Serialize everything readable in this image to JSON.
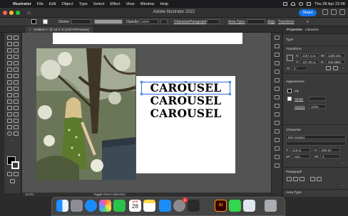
{
  "menubar": {
    "app": "Illustrator",
    "items": [
      "File",
      "Edit",
      "Object",
      "Type",
      "Select",
      "Effect",
      "View",
      "Window",
      "Help"
    ],
    "clock": "Thu 28 Apr  22:06"
  },
  "window": {
    "title": "Adobe Illustrator 2022",
    "share_label": "Share"
  },
  "control_bar": {
    "stroke_label": "Stroke:",
    "opacity_label": "Opacity:",
    "opacity_value": "100%",
    "character_label": "Character",
    "paragraph_label": "Paragraph",
    "area_type_label": "Area Type:",
    "align_label": "Align",
    "transform_label": "Transform"
  },
  "document_tab": {
    "label": "Untitled-1* @ 16.2 % (CMYK/Preview)"
  },
  "artboard": {
    "lines": [
      "CAROUSEL",
      "CAROUSEL",
      "CAROUSEL"
    ]
  },
  "status_bar": {
    "zoom": "16.2%",
    "tool_hint": "Toggle Direct Selection"
  },
  "properties_panel": {
    "tab_properties": "Properties",
    "tab_libraries": "Libraries",
    "type_section": "Type",
    "transform_section": "Transform",
    "x_label": "X:",
    "x_value": "2157.3 px",
    "y_label": "Y:",
    "y_value": "187.95 px",
    "w_label": "W:",
    "w_value": "1269.245",
    "h_label": "H:",
    "h_value": "206.8966",
    "angle_value": "0°",
    "appearance_section": "Appearance",
    "fill_label": "Fill",
    "stroke_label": "Stroke",
    "opacity_label": "Opacity",
    "opacity_value": "100%",
    "character_section": "Character",
    "font_name": "Bely Display",
    "font_size": "215 pt",
    "leading": "(258 pt)",
    "tracking": "Auto",
    "kerning": "0",
    "paragraph_section": "Paragraph",
    "area_type_section": "Area Type"
  },
  "dock": {
    "calendar_month": "APR",
    "calendar_day": "28",
    "badge": "1",
    "ai_label": "Ai"
  },
  "colors": {
    "accent": "#1473e6",
    "selection": "#2b6ce0",
    "illustrator_orange": "#ff9a00"
  }
}
